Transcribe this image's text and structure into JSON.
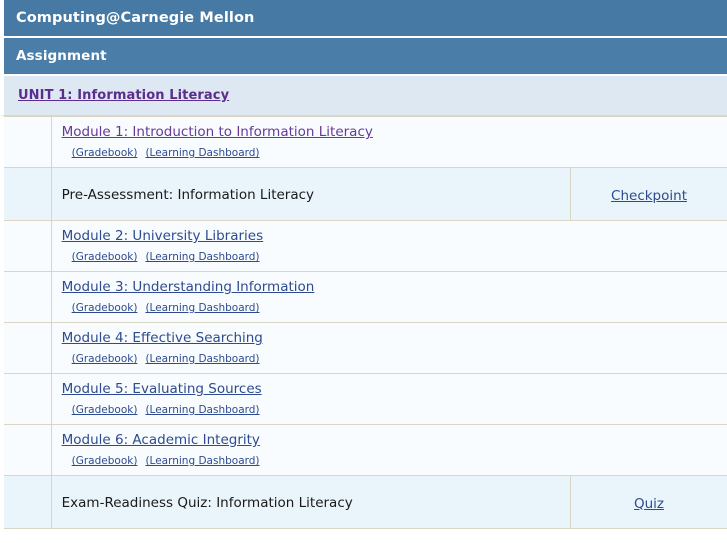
{
  "header": {
    "app_title": "Computing@Carnegie Mellon",
    "section_title": "Assignment"
  },
  "unit": {
    "label": "UNIT 1: Information Literacy"
  },
  "sublink_labels": {
    "gradebook": "(Gradebook)",
    "learning_dashboard": "(Learning Dashboard)"
  },
  "colors": {
    "header_bar": "#4679a4",
    "unit_row": "#dde8f2",
    "module_row": "#f8fcff",
    "assessment_row": "#e9f4fb",
    "link_blue": "#2e4b8f",
    "link_purple": "#68389a",
    "border": "#d9d6c3"
  },
  "rows": [
    {
      "kind": "module",
      "title": "Module 1: Introduction to Information Literacy",
      "visited": true,
      "gradebook": "(Gradebook)",
      "dashboard": "(Learning Dashboard)",
      "action": ""
    },
    {
      "kind": "assessment",
      "title": "Pre-Assessment: Information Literacy",
      "action": "Checkpoint"
    },
    {
      "kind": "module",
      "title": "Module 2: University Libraries",
      "visited": false,
      "gradebook": "(Gradebook)",
      "dashboard": "(Learning Dashboard)",
      "action": ""
    },
    {
      "kind": "module",
      "title": "Module 3: Understanding Information",
      "visited": false,
      "gradebook": "(Gradebook)",
      "dashboard": "(Learning Dashboard)",
      "action": ""
    },
    {
      "kind": "module",
      "title": "Module 4: Effective Searching",
      "visited": false,
      "gradebook": "(Gradebook)",
      "dashboard": "(Learning Dashboard)",
      "action": ""
    },
    {
      "kind": "module",
      "title": "Module 5: Evaluating Sources",
      "visited": false,
      "gradebook": "(Gradebook)",
      "dashboard": "(Learning Dashboard)",
      "action": ""
    },
    {
      "kind": "module",
      "title": "Module 6: Academic Integrity",
      "visited": false,
      "gradebook": "(Gradebook)",
      "dashboard": "(Learning Dashboard)",
      "action": ""
    },
    {
      "kind": "assessment",
      "title": "Exam-Readiness Quiz: Information Literacy",
      "action": "Quiz"
    }
  ]
}
